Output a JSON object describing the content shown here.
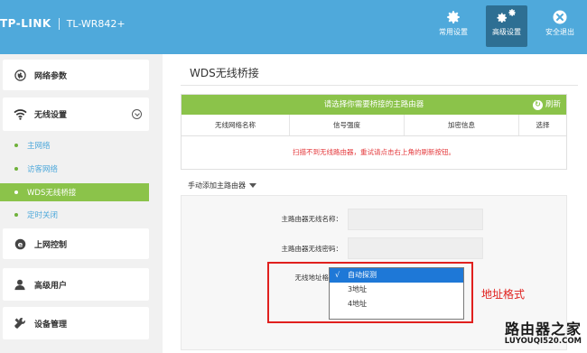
{
  "header": {
    "brand": "TP-LINK",
    "model": "TL-WR842+",
    "buttons": [
      {
        "label": "常用设置",
        "icon": "gear-icon"
      },
      {
        "label": "高级设置",
        "icon": "gears-icon"
      },
      {
        "label": "安全退出",
        "icon": "close-icon"
      }
    ]
  },
  "sidebar": {
    "network_params": "网络参数",
    "wireless": "无线设置",
    "sub_items": [
      "主网络",
      "访客网络",
      "WDS无线桥接",
      "定时关闭"
    ],
    "active_sub": "WDS无线桥接",
    "internet_control": "上网控制",
    "advanced_users": "高级用户",
    "device_mgmt": "设备管理"
  },
  "main": {
    "title": "WDS无线桥接",
    "scan": {
      "header": "请选择你需要桥接的主路由器",
      "refresh": "刷新",
      "columns": [
        "无线网络名称",
        "信号强度",
        "加密信息",
        "选择"
      ],
      "empty_message": "扫描不到无线路由器，重试请点击右上角的刷新按钮。"
    },
    "manual_add": "手动添加主路由器",
    "form": {
      "ssid_label": "主路由器无线名称：",
      "ssid_value": "",
      "password_label": "主路由器无线密码：",
      "password_value": "",
      "mac_format_label": "无线地址格式："
    },
    "dropdown": {
      "options": [
        "自动探测",
        "3地址",
        "4地址"
      ],
      "selected": "自动探测"
    },
    "annotation": "地址格式"
  },
  "watermark": {
    "line1": "路由器之家",
    "line2": "LUYOUQI520.COM"
  },
  "colors": {
    "header_bg": "#4fa9db",
    "active_btn": "#2e6f93",
    "green": "#8bc34a",
    "select_blue": "#1e78d7",
    "annotation_red": "#e0201e"
  }
}
